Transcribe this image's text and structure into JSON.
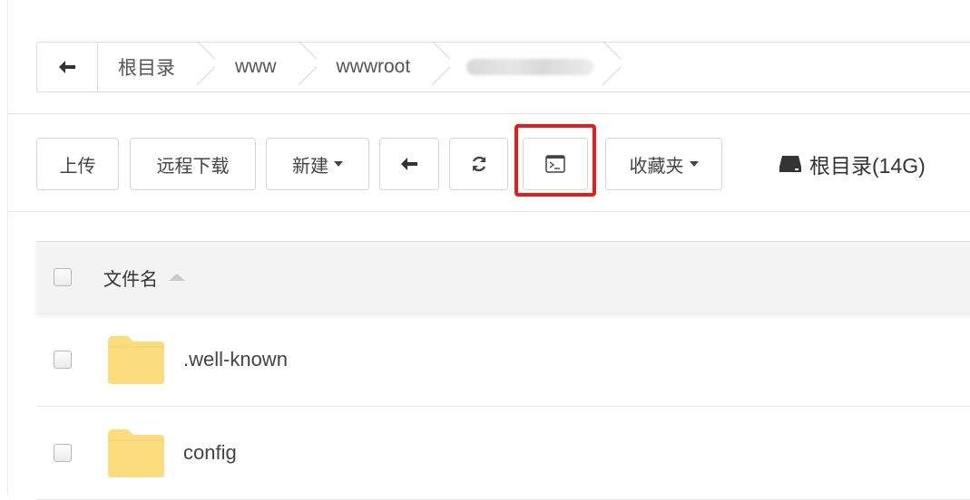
{
  "breadcrumb": {
    "back_icon": "arrow-left-icon",
    "items": [
      "根目录",
      "www",
      "wwwroot"
    ],
    "last_item_blurred": true
  },
  "toolbar": {
    "upload": "上传",
    "remote_download": "远程下载",
    "new": "新建",
    "back_icon": "arrow-left-icon",
    "refresh_icon": "refresh-icon",
    "terminal_icon": "terminal-icon",
    "favorites": "收藏夹",
    "disk_label": "根目录(14G)",
    "disk_icon": "hard-drive-icon",
    "highlight_color": "#e02020"
  },
  "table": {
    "header_name": "文件名",
    "rows": [
      {
        "name": ".well-known",
        "type": "folder"
      },
      {
        "name": "config",
        "type": "folder"
      }
    ],
    "folder_color": "#fbdc7e"
  }
}
